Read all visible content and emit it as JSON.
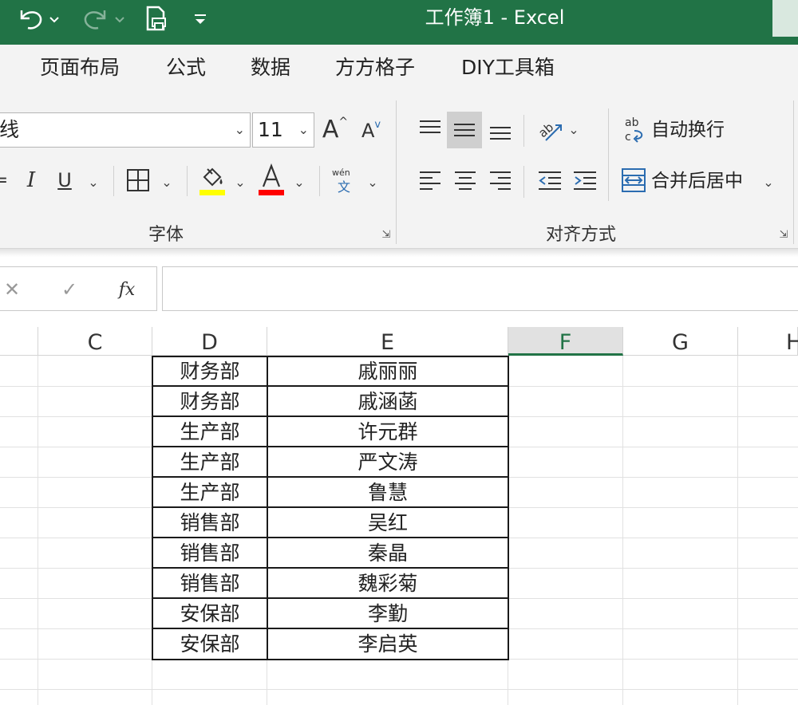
{
  "titlebar": {
    "title": "工作簿1  -  Excel"
  },
  "ribbon_tabs": [
    "页面布局",
    "公式",
    "数据",
    "方方格子",
    "DIY工具箱"
  ],
  "font": {
    "name_value": "线",
    "size_value": "11",
    "grow_label": "A",
    "shrink_label": "A",
    "italic_label": "I",
    "underline_label": "U",
    "group_label": "字体"
  },
  "alignment": {
    "wrap_label": "自动换行",
    "merge_label": "合并后居中",
    "group_label": "对齐方式"
  },
  "formula_bar": {
    "fx_label": "fx",
    "value": ""
  },
  "columns": [
    "C",
    "D",
    "E",
    "F",
    "G",
    "H"
  ],
  "table": {
    "rows": [
      [
        "财务部",
        "戚丽丽"
      ],
      [
        "财务部",
        "戚涵菡"
      ],
      [
        "生产部",
        "许元群"
      ],
      [
        "生产部",
        "严文涛"
      ],
      [
        "生产部",
        "鲁慧"
      ],
      [
        "销售部",
        "吴红"
      ],
      [
        "销售部",
        "秦晶"
      ],
      [
        "销售部",
        "魏彩菊"
      ],
      [
        "安保部",
        "李勤"
      ],
      [
        "安保部",
        "李启英"
      ]
    ]
  },
  "colors": {
    "excel_green": "#217346",
    "highlight_yellow": "#ffff00",
    "font_red": "#ff0000"
  }
}
